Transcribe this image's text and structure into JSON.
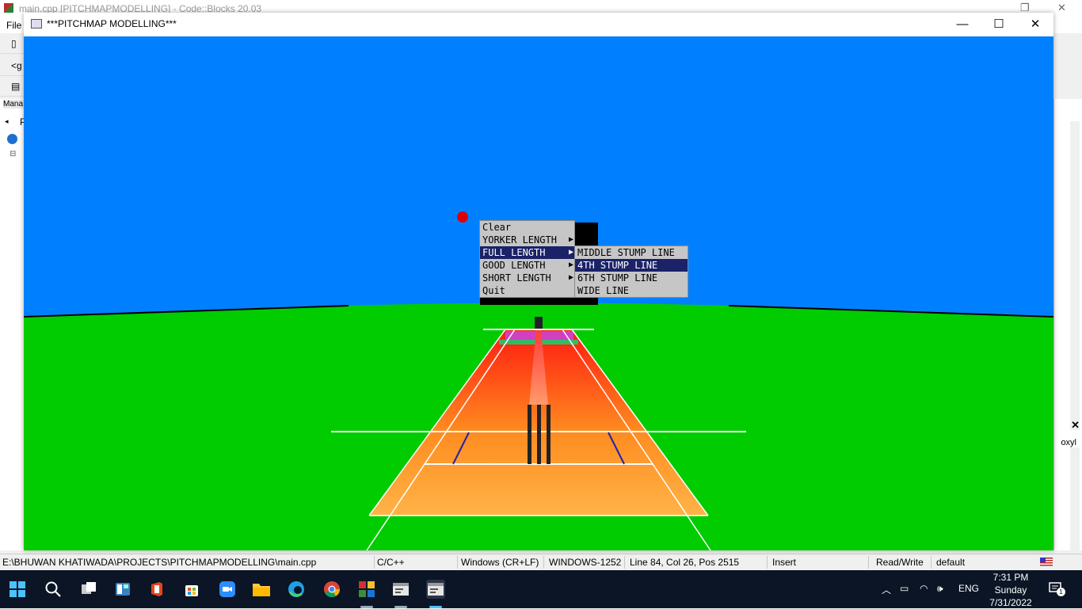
{
  "ide": {
    "title": "main.cpp [PITCHMAPMODELLING] - Code::Blocks 20.03",
    "menu_first": "File",
    "toolbar_partial": "<g",
    "mgmt_label": "Mana",
    "tree_partial": "P",
    "right_partial": "oxyl"
  },
  "app": {
    "title": "***PITCHMAP MODELLING***",
    "minimize_icon": "minimize-icon",
    "maximize_icon": "maximize-icon",
    "close_icon": "close-icon"
  },
  "scene": {
    "sky_color": "#0080ff",
    "ground_color": "#00cc00",
    "ball_color": "#dd0000",
    "pitch_colors": [
      "#ff1a10",
      "#ffb347"
    ]
  },
  "context_menu": {
    "items": [
      {
        "label": "Clear",
        "has_submenu": false
      },
      {
        "label": "YORKER LENGTH",
        "has_submenu": true
      },
      {
        "label": "FULL LENGTH",
        "has_submenu": true,
        "selected": true
      },
      {
        "label": "GOOD LENGTH",
        "has_submenu": true
      },
      {
        "label": "SHORT LENGTH",
        "has_submenu": true
      },
      {
        "label": "Quit",
        "has_submenu": false
      }
    ],
    "submenu": [
      {
        "label": "MIDDLE STUMP LINE"
      },
      {
        "label": "4TH STUMP LINE",
        "selected": true
      },
      {
        "label": "6TH STUMP LINE"
      },
      {
        "label": "WIDE LINE"
      }
    ]
  },
  "statusbar": {
    "path": "E:\\BHUWAN KHATIWADA\\PROJECTS\\PITCHMAPMODELLING\\main.cpp",
    "language": "C/C++",
    "line_endings": "Windows (CR+LF)",
    "encoding": "WINDOWS-1252",
    "position": "Line 84, Col 26, Pos 2515",
    "mode": "Insert",
    "access": "Read/Write",
    "profile": "default"
  },
  "taskbar": {
    "icons": [
      "windows-start-icon",
      "search-icon",
      "task-view-icon",
      "widgets-icon",
      "office-icon",
      "store-icon",
      "zoom-icon",
      "file-explorer-icon",
      "edge-icon",
      "chrome-icon",
      "codeblocks-icon",
      "app-window-icon",
      "app-window-active-icon"
    ],
    "tray_language": "ENG",
    "time": "7:31 PM",
    "day": "Sunday",
    "date": "7/31/2022",
    "notification_count": "1"
  }
}
